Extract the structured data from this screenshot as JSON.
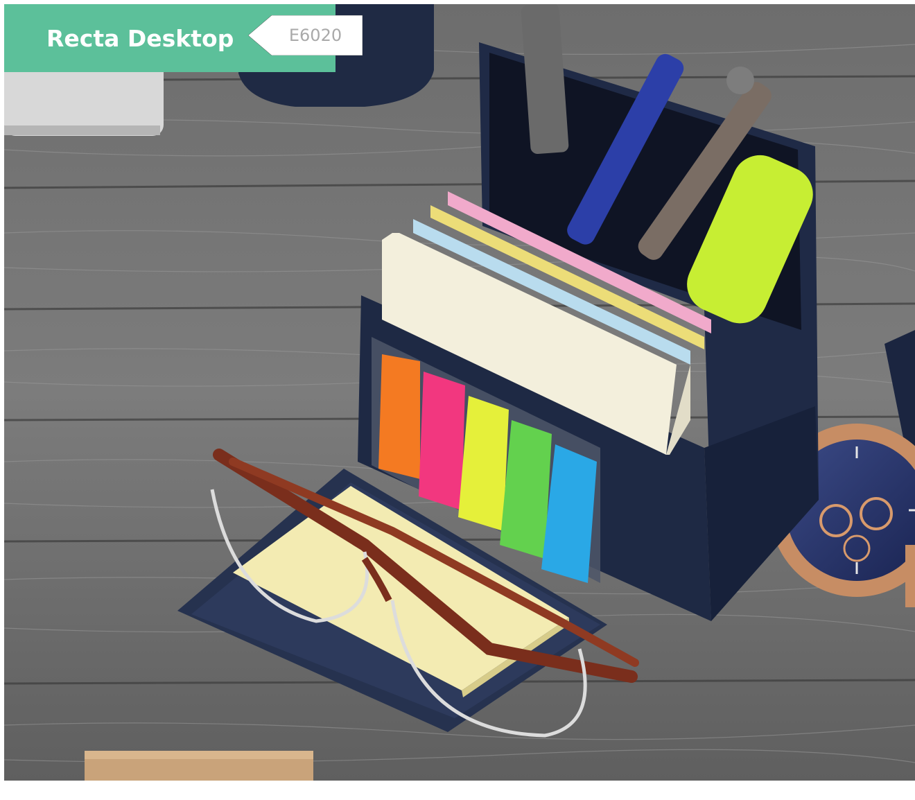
{
  "header": {
    "title": "Recta Desktop",
    "product_code": "E6020"
  },
  "colors": {
    "banner": "#5cc09a",
    "tag_background": "#ffffff",
    "tag_text": "#a9a9a9",
    "organizer": "#27334a"
  },
  "photo": {
    "sticky_flag_colors": [
      "#f47a22",
      "#f2377f",
      "#e5f03a",
      "#63d14e",
      "#2aa8e6"
    ],
    "sticky_note_colors": [
      "#f3efdc",
      "#b9dcee",
      "#ecdd78",
      "#f1aacb"
    ]
  }
}
